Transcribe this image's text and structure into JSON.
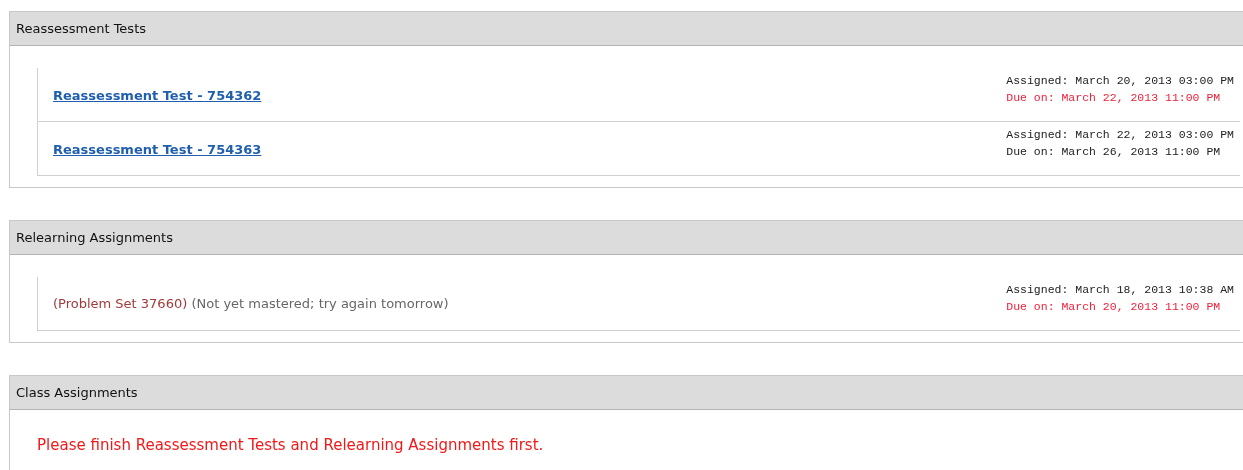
{
  "sections": [
    {
      "title": "Reassessment Tests",
      "kind": "tests",
      "items": [
        {
          "link": "Reassessment Test - 754362",
          "assigned": "Assigned: March 20, 2013 03:00 PM",
          "due": "Due on: March 22, 2013 11:00 PM",
          "overdue": true
        },
        {
          "link": "Reassessment Test - 754363",
          "assigned": "Assigned: March 22, 2013 03:00 PM",
          "due": "Due on: March 26, 2013 11:00 PM",
          "overdue": false
        }
      ]
    },
    {
      "title": "Relearning Assignments",
      "kind": "relearning",
      "items": [
        {
          "problem_set": "(Problem Set 37660)",
          "note": "(Not yet mastered; try again tomorrow)",
          "assigned": "Assigned: March 18, 2013 10:38 AM",
          "due": "Due on: March 20, 2013 11:00 PM",
          "overdue": true
        }
      ]
    },
    {
      "title": "Class Assignments",
      "kind": "message",
      "message": "Please finish Reassessment Tests and Relearning Assignments first."
    }
  ]
}
